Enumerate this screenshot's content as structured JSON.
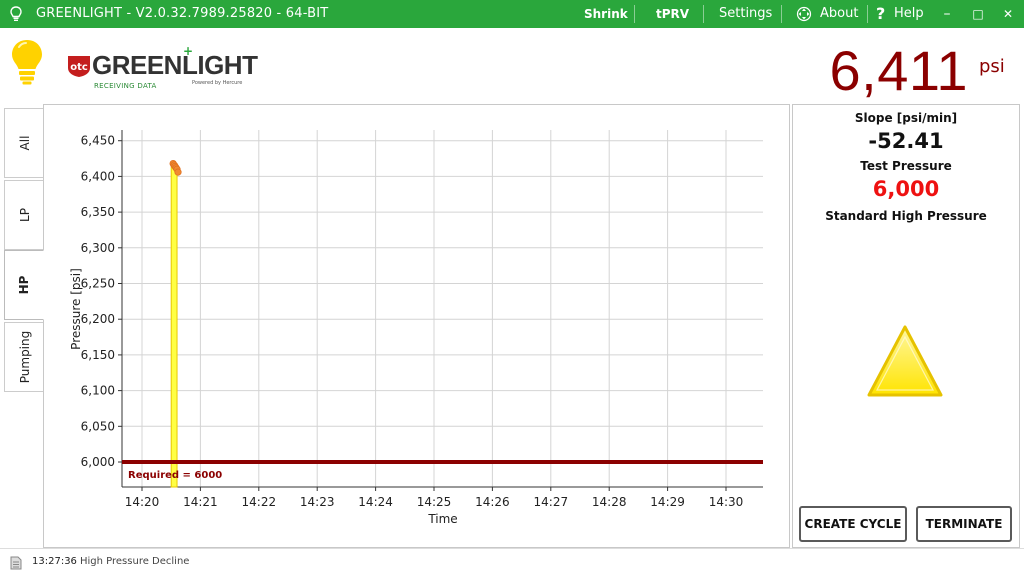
{
  "window": {
    "title": "GREENLIGHT - V2.0.32.7989.25820 - 64-BIT",
    "menu": {
      "shrink": "Shrink",
      "tprv": "tPRV",
      "settings": "Settings",
      "about": "About",
      "help": "Help"
    },
    "controls": {
      "minimize": "–",
      "maximize": "□",
      "close": "✕"
    }
  },
  "logo": {
    "brand": "GREENLIGHT",
    "status": "RECEIVING DATA",
    "powered": "Powered by Hercure",
    "otc": "otc"
  },
  "readout": {
    "value": "6,411",
    "unit": "psi"
  },
  "tabs": [
    {
      "label": "All",
      "active": false
    },
    {
      "label": "LP",
      "active": false
    },
    {
      "label": "HP",
      "active": true
    },
    {
      "label": "Pumping",
      "active": false
    }
  ],
  "metrics": {
    "slope_label": "Slope [psi/min]",
    "slope_value": "-52.41",
    "test_pressure_label": "Test Pressure",
    "test_pressure_value": "6,000",
    "mode_label": "Standard High Pressure"
  },
  "buttons": {
    "create_cycle": "CREATE CYCLE",
    "terminate": "TERMINATE"
  },
  "status": {
    "time": "13:27:36",
    "message": "High Pressure Decline"
  },
  "colors": {
    "titlebar": "#2aa73c",
    "readout": "#8b0000",
    "test_pressure": "#ee1111",
    "required_line": "#8b0000",
    "bar_fill": "#ffff44",
    "bar_stroke": "#e8c800",
    "points": "#f08a30",
    "warning": "#ffe000"
  },
  "chart_data": {
    "type": "line",
    "xlabel": "Time",
    "ylabel": "Pressure [psi]",
    "x_ticks": [
      "14:20",
      "14:21",
      "14:22",
      "14:23",
      "14:24",
      "14:25",
      "14:26",
      "14:27",
      "14:28",
      "14:29",
      "14:30"
    ],
    "y_ticks": [
      "6,450",
      "6,400",
      "6,350",
      "6,300",
      "6,250",
      "6,200",
      "6,150",
      "6,100",
      "6,050",
      "6,000"
    ],
    "xlim_minutes": [
      14.33,
      14.51
    ],
    "ylim": [
      5965,
      6465
    ],
    "grid": true,
    "required": {
      "value": 6000,
      "label": "Required = 6000"
    },
    "highlight_window": {
      "start": "14:20:30",
      "end": "14:20:36"
    },
    "series": [
      {
        "x": [
          "14:20:32",
          "14:20:33",
          "14:20:34",
          "14:20:35",
          "14:20:36",
          "14:20:37"
        ],
        "y": [
          6418,
          6416,
          6414,
          6412,
          6410,
          6406
        ]
      }
    ]
  }
}
